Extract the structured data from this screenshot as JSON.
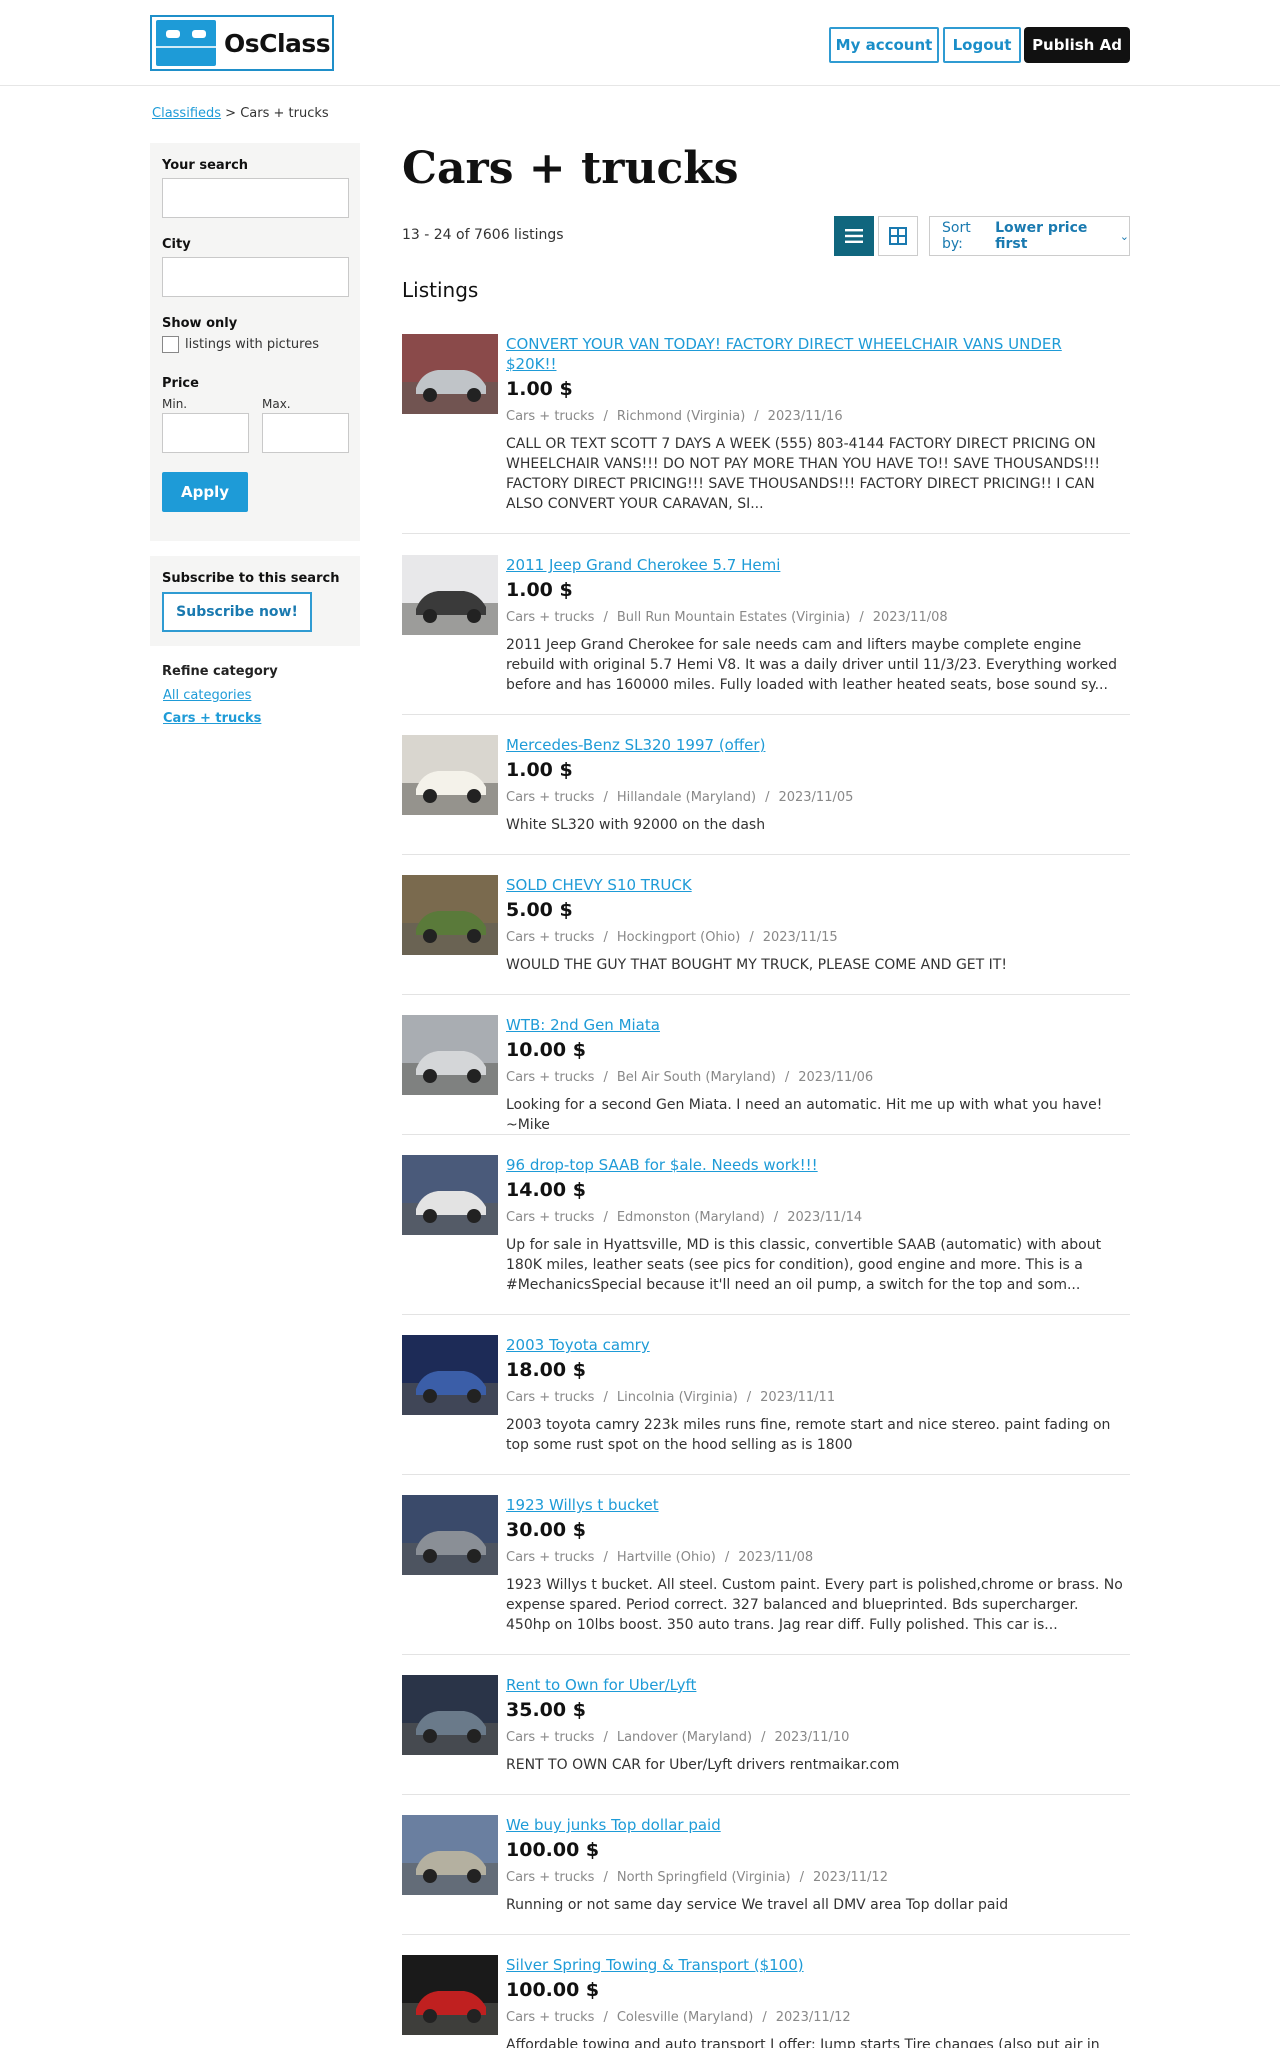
{
  "header": {
    "logo_text": "OsClass",
    "my_account": "My account",
    "logout": "Logout",
    "publish_ad": "Publish Ad"
  },
  "breadcrumb": {
    "home": "Classifieds",
    "sep": ">",
    "current": "Cars + trucks"
  },
  "sidebar": {
    "your_search_label": "Your search",
    "your_search_value": "",
    "city_label": "City",
    "city_value": "",
    "show_only_label": "Show only",
    "pictures_label": "listings with pictures",
    "price_label": "Price",
    "min_label": "Min.",
    "max_label": "Max.",
    "apply_label": "Apply",
    "subscribe_heading": "Subscribe to this search",
    "subscribe_button": "Subscribe now!",
    "refine_label": "Refine category",
    "all_categories": "All categories",
    "current_category": "Cars + trucks"
  },
  "main": {
    "title": "Cars + trucks",
    "count": "13 - 24 of 7606 listings",
    "sort_prefix": "Sort by:",
    "sort_value": "Lower price first",
    "listings_heading": "Listings"
  },
  "listings": [
    {
      "title": "CONVERT YOUR VAN TODAY! FACTORY DIRECT WHEELCHAIR VANS UNDER $20K!!",
      "price": "1.00 $",
      "category": "Cars + trucks",
      "location": "Richmond (Virginia)",
      "date": "2023/11/16",
      "desc": "CALL OR TEXT SCOTT 7 DAYS A WEEK (555) 803-4144 FACTORY DIRECT PRICING ON WHEELCHAIR VANS!!! DO NOT PAY MORE THAN YOU HAVE TO!! SAVE THOUSANDS!!! FACTORY DIRECT PRICING!!! SAVE THOUSANDS!!! FACTORY DIRECT PRICING!! I CAN ALSO CONVERT YOUR CARAVAN, SI..."
    },
    {
      "title": "2011 Jeep Grand Cherokee 5.7 Hemi",
      "price": "1.00 $",
      "category": "Cars + trucks",
      "location": "Bull Run Mountain Estates (Virginia)",
      "date": "2023/11/08",
      "desc": "2011 Jeep Grand Cherokee for sale needs cam and lifters maybe complete engine rebuild with original 5.7 Hemi V8. It was a daily driver until 11/3/23. Everything worked before and has 160000 miles. Fully loaded with leather heated seats, bose sound sy..."
    },
    {
      "title": "Mercedes-Benz SL320 1997 (offer)",
      "price": "1.00 $",
      "category": "Cars + trucks",
      "location": "Hillandale (Maryland)",
      "date": "2023/11/05",
      "desc": "White SL320 with 92000 on the dash"
    },
    {
      "title": "SOLD CHEVY S10 TRUCK",
      "price": "5.00 $",
      "category": "Cars + trucks",
      "location": "Hockingport (Ohio)",
      "date": "2023/11/15",
      "desc": "WOULD THE GUY THAT BOUGHT MY TRUCK, PLEASE COME AND GET IT!"
    },
    {
      "title": "WTB: 2nd Gen Miata",
      "price": "10.00 $",
      "category": "Cars + trucks",
      "location": "Bel Air South (Maryland)",
      "date": "2023/11/06",
      "desc": "Looking for a second Gen Miata. I need an automatic. Hit me up with what you have! ~Mike"
    },
    {
      "title": "96 drop-top SAAB for $ale. Needs work!!!",
      "price": "14.00 $",
      "category": "Cars + trucks",
      "location": "Edmonston (Maryland)",
      "date": "2023/11/14",
      "desc": "Up for sale in Hyattsville, MD is this classic, convertible SAAB (automatic) with about 180K miles, leather seats (see pics for condition), good engine and more. This is a #MechanicsSpecial because it'll need an oil pump, a switch for the top and som..."
    },
    {
      "title": "2003 Toyota camry",
      "price": "18.00 $",
      "category": "Cars + trucks",
      "location": "Lincolnia (Virginia)",
      "date": "2023/11/11",
      "desc": "2003 toyota camry 223k miles runs fine, remote start and nice stereo. paint fading on top some rust spot on the hood selling as is 1800"
    },
    {
      "title": "1923 Willys t bucket",
      "price": "30.00 $",
      "category": "Cars + trucks",
      "location": "Hartville (Ohio)",
      "date": "2023/11/08",
      "desc": "1923 Willys t bucket. All steel. Custom paint. Every part is polished,chrome or brass. No expense spared. Period correct. 327 balanced and blueprinted. Bds supercharger. 450hp on 10lbs boost. 350 auto trans. Jag rear diff. Fully polished. This car is..."
    },
    {
      "title": "Rent to Own for Uber/Lyft",
      "price": "35.00 $",
      "category": "Cars + trucks",
      "location": "Landover (Maryland)",
      "date": "2023/11/10",
      "desc": "RENT TO OWN CAR for Uber/Lyft drivers rentmaikar.com"
    },
    {
      "title": "We buy junks Top dollar paid",
      "price": "100.00 $",
      "category": "Cars + trucks",
      "location": "North Springfield (Virginia)",
      "date": "2023/11/12",
      "desc": "Running or not same day service We travel all DMV area Top dollar paid"
    },
    {
      "title": "Silver Spring Towing & Transport ($100)",
      "price": "100.00 $",
      "category": "Cars + trucks",
      "location": "Colesville (Maryland)",
      "date": "2023/11/12",
      "desc": "Affordable towing and auto transport I offer: Jump starts Tire changes (also put air in tires)"
    }
  ],
  "thumb_colors": [
    "#8a4a4a",
    "#e8e8ea",
    "#d9d6cf",
    "#7a6a4e",
    "#a9adb2",
    "#4a5a7a",
    "#1d2b57",
    "#3a4a6a",
    "#2a3448",
    "#6a7fa0",
    "#1a1a1a"
  ],
  "thumb_accents": [
    "#c0c4c8",
    "#3a3a3a",
    "#f4f2ea",
    "#5a7a3a",
    "#d4d6d8",
    "#e3e3e3",
    "#3b5ea8",
    "#8a8f96",
    "#6a7a8a",
    "#b4b0a0",
    "#c02020"
  ]
}
